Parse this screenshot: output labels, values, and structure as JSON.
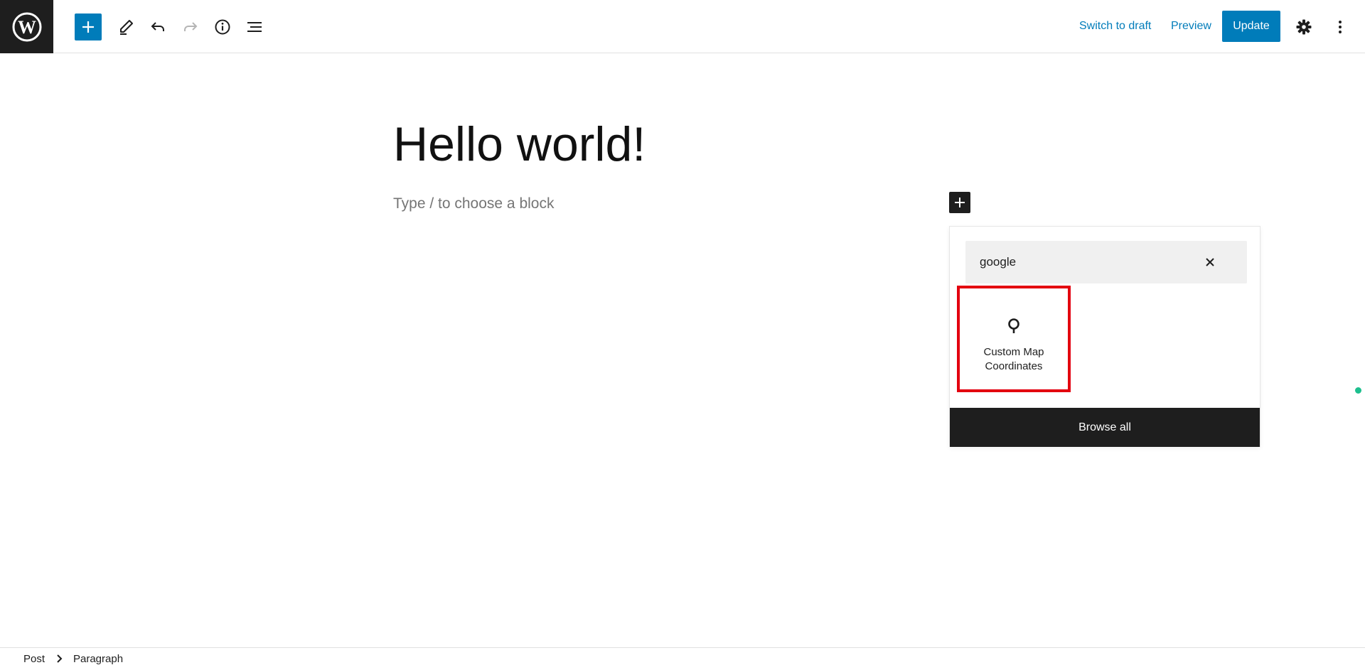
{
  "colors": {
    "accent": "#007cba",
    "dark": "#1e1e1e",
    "highlight": "#e3000f",
    "status": "#1dbf8e"
  },
  "toolbar": {
    "logo": "wordpress-logo",
    "icons": [
      "plus-icon",
      "pencil-icon",
      "undo-icon",
      "redo-icon",
      "info-icon",
      "list-view-icon"
    ],
    "switch_to_draft": "Switch to draft",
    "preview": "Preview",
    "update": "Update",
    "settings_icon": "gear-icon",
    "options_icon": "more-vertical-icon"
  },
  "editor": {
    "title": "Hello world!",
    "placeholder": "Type / to choose a block"
  },
  "inserter": {
    "search_value": "google",
    "results": [
      {
        "label": "Custom Map Coordinates",
        "icon": "map-pin-icon"
      }
    ],
    "browse_all": "Browse all"
  },
  "breadcrumb": [
    "Post",
    "Paragraph"
  ]
}
